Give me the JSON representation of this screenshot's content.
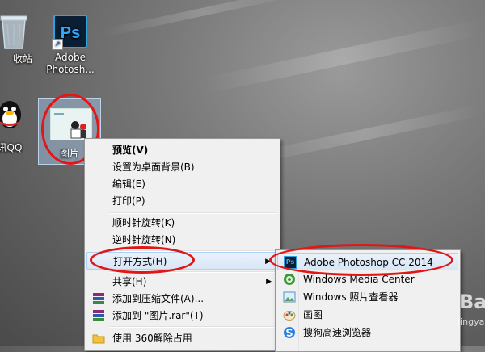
{
  "desktop": {
    "icons": [
      {
        "label": "收站"
      },
      {
        "label": "Adobe\nPhotosh..."
      },
      {
        "label": "讯QQ"
      },
      {
        "label": "图片"
      }
    ]
  },
  "context_menu": {
    "items": [
      {
        "label": "预览(V)"
      },
      {
        "label": "设置为桌面背景(B)"
      },
      {
        "label": "编辑(E)"
      },
      {
        "label": "打印(P)"
      },
      {
        "label": "顺时针旋转(K)"
      },
      {
        "label": "逆时针旋转(N)"
      },
      {
        "label": "打开方式(H)"
      },
      {
        "label": "共享(H)"
      },
      {
        "label": "添加到压缩文件(A)..."
      },
      {
        "label": "添加到 \"图片.rar\"(T)"
      },
      {
        "label": "使用 360解除占用"
      }
    ]
  },
  "open_with_menu": {
    "items": [
      {
        "label": "Adobe Photoshop CC 2014",
        "icon": "photoshop-icon"
      },
      {
        "label": "Windows Media Center",
        "icon": "media-center-icon"
      },
      {
        "label": "Windows 照片查看器",
        "icon": "photo-viewer-icon"
      },
      {
        "label": "画图",
        "icon": "paint-icon"
      },
      {
        "label": "搜狗高速浏览器",
        "icon": "sogou-browser-icon"
      }
    ]
  },
  "colors": {
    "highlight_ellipse": "#e11717",
    "ps_blue": "#31a8ff"
  },
  "watermark": {
    "text": "Ba",
    "sub": "jingya"
  }
}
